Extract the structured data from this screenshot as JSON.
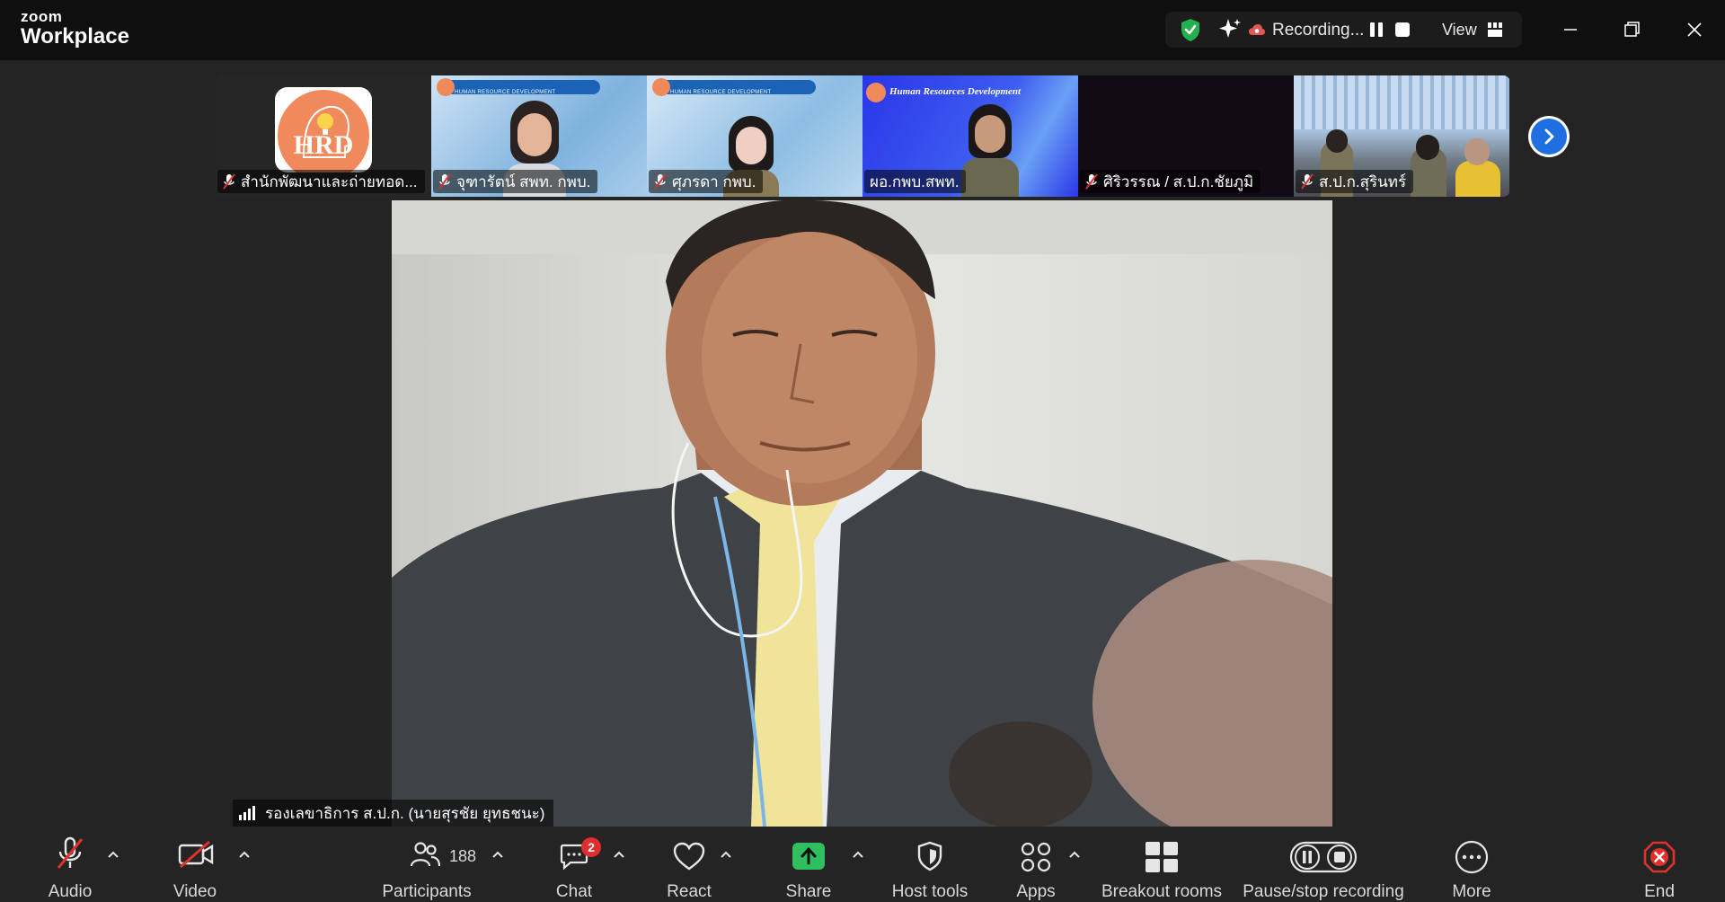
{
  "app": {
    "brand_top": "zoom",
    "brand_bottom": "Workplace"
  },
  "recording": {
    "status_label": "Recording...",
    "view_label": "View"
  },
  "window_controls": [
    "minimize-icon",
    "restore-icon",
    "close-icon"
  ],
  "participants_strip": [
    {
      "name": "สำนักพัฒนาและถ่ายทอด...",
      "muted": true,
      "logo_text": "HRD"
    },
    {
      "name": "จุฑารัตน์ สพท. กพบ.",
      "muted": true,
      "banner": "HUMAN RESOURCE DEVELOPMENT"
    },
    {
      "name": "ศุภรดา กพบ.",
      "muted": true,
      "banner": "HUMAN RESOURCE DEVELOPMENT"
    },
    {
      "name": "ผอ.กพบ.สพท.",
      "muted": false,
      "banner": "Human Resources Development"
    },
    {
      "name": "ศิริวรรณ / ส.ป.ก.ชัยภูมิ",
      "muted": true
    },
    {
      "name": "ส.ป.ก.สุรินทร์",
      "muted": true
    }
  ],
  "active_speaker": {
    "name": "รองเลขาธิการ ส.ป.ก. (นายสุรชัย ยุทธชนะ)"
  },
  "toolbar": {
    "audio": "Audio",
    "video": "Video",
    "participants": "Participants",
    "participants_count": "188",
    "chat": "Chat",
    "chat_badge": "2",
    "react": "React",
    "share": "Share",
    "host_tools": "Host tools",
    "apps": "Apps",
    "breakout": "Breakout rooms",
    "pause_stop": "Pause/stop recording",
    "more": "More",
    "end": "End"
  },
  "colors": {
    "accent_blue": "#1f6fe0",
    "share_green": "#2fbf5f",
    "badge_red": "#e02d2d",
    "shield_green": "#22b14c"
  }
}
